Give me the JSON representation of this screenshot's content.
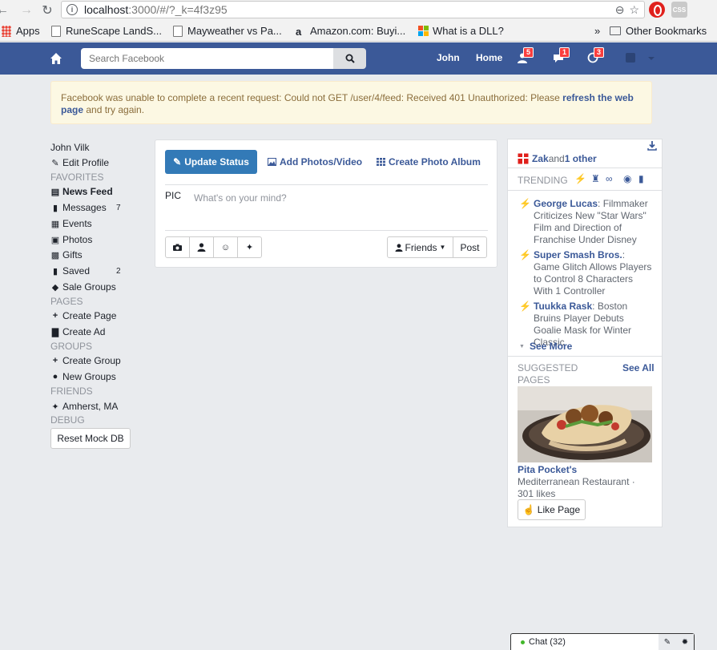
{
  "browser": {
    "url_host": "localhost",
    "url_path": ":3000/#/?_k=4f3z95",
    "bookmarks": [
      {
        "label": "Apps"
      },
      {
        "label": "RuneScape LandS..."
      },
      {
        "label": "Mayweather vs Pa..."
      },
      {
        "label": "Amazon.com: Buyi..."
      },
      {
        "label": "What is a DLL?"
      },
      {
        "label": "»"
      },
      {
        "label": "Other Bookmarks"
      }
    ]
  },
  "topbar": {
    "search_placeholder": "Search Facebook",
    "user_link": "John",
    "home_link": "Home",
    "friend_requests_count": "5",
    "messages_count": "1",
    "notifications_count": "3"
  },
  "alert": {
    "text_before": "Facebook was unable to complete a recent request: Could not GET /user/4/feed: Received 401 Unauthorized: Please ",
    "link_text": "refresh the web page",
    "text_after": " and try again."
  },
  "leftnav": {
    "user_name": "John Vilk",
    "edit_profile": "Edit Profile",
    "favorites_header": "FAVORITES",
    "news_feed": "News Feed",
    "messages": "Messages",
    "messages_count": "7",
    "events": "Events",
    "photos": "Photos",
    "gifts": "Gifts",
    "saved": "Saved",
    "saved_count": "2",
    "sale_groups": "Sale Groups",
    "pages_header": "PAGES",
    "create_page": "Create Page",
    "create_ad": "Create Ad",
    "groups_header": "GROUPS",
    "create_group": "Create Group",
    "new_groups": "New Groups",
    "friends_header": "FRIENDS",
    "amherst": "Amherst, MA",
    "debug_header": "DEBUG",
    "reset_button": "Reset Mock DB"
  },
  "composer": {
    "update_status": "Update Status",
    "add_photos": "Add Photos/Video",
    "create_album": "Create Photo Album",
    "pic_label": "PIC",
    "placeholder": "What's on your mind?",
    "audience": "Friends",
    "post": "Post"
  },
  "rightcol": {
    "birthday_name": "Zak",
    "birthday_and": " and ",
    "birthday_other": "1 other",
    "trending_label": "TRENDING",
    "trends": [
      {
        "title": "George Lucas",
        "text": ": Filmmaker Criticizes New \"Star Wars\" Film and Direction of Franchise Under Disney"
      },
      {
        "title": "Super Smash Bros.",
        "text": ": Game Glitch Allows Players to Control 8 Characters With 1 Controller"
      },
      {
        "title": "Tuukka Rask",
        "text": ": Boston Bruins Player Debuts Goalie Mask for Winter Classic"
      }
    ],
    "see_more": "See More",
    "suggested_label": "SUGGESTED PAGES",
    "see_all": "See All",
    "page_name": "Pita Pocket's",
    "page_desc": "Mediterranean Restaurant · 301 likes",
    "like_page": "Like Page"
  },
  "chat": {
    "label": "Chat (32)"
  },
  "colors": {
    "fb_blue": "#3b5998",
    "primary_button": "#337ab7",
    "alert_bg": "#fcf8e3",
    "badge_red": "#fa3e3e"
  }
}
